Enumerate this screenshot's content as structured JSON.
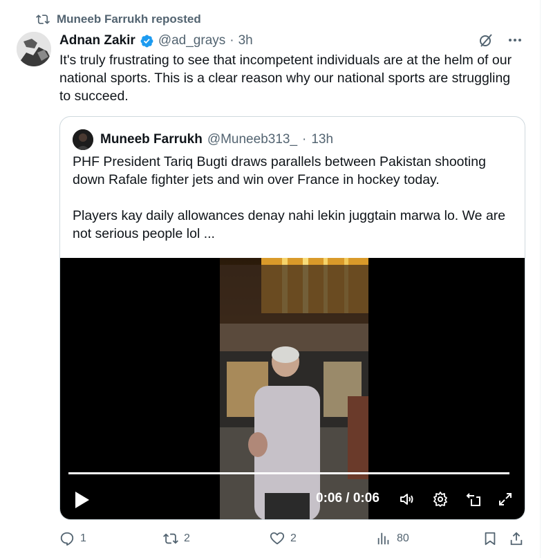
{
  "repost": {
    "label": "Muneeb Farrukh reposted"
  },
  "tweet": {
    "author_name": "Adnan Zakir",
    "handle": "@ad_grays",
    "separator": "·",
    "time": "3h",
    "text": "It's truly frustrating to see that incompetent individuals are at the helm of our national sports. This is a clear reason why our national sports are struggling to succeed."
  },
  "quote": {
    "author_name": "Muneeb Farrukh",
    "handle": "@Muneeb313_",
    "separator": "·",
    "time": "13h",
    "text_p1": "PHF President Tariq Bugti draws parallels between Pakistan shooting down Rafale fighter jets and win over France in hockey today.",
    "text_p2": "Players kay daily allowances denay nahi lekin juggtain marwa lo. We are not serious people lol ..."
  },
  "video": {
    "time_readout": "0:06 / 0:06",
    "progress": 1.0
  },
  "actions": {
    "replies": "1",
    "reposts": "2",
    "likes": "2",
    "views": "80"
  },
  "colors": {
    "verified": "#1d9bf0",
    "muted": "#536471",
    "text": "#0f1419"
  }
}
